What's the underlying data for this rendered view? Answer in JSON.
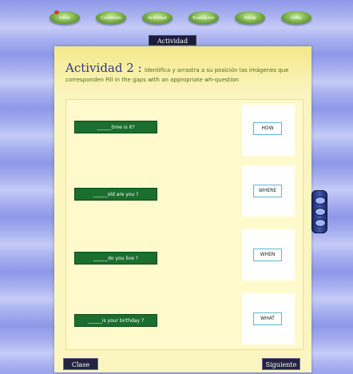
{
  "nav": {
    "items": [
      {
        "label": "Inicio",
        "icon": "leaf-icon"
      },
      {
        "label": "Contenido",
        "icon": "leaf-icon"
      },
      {
        "label": "Actividad",
        "icon": "leaf-icon"
      },
      {
        "label": "Evaluación",
        "icon": "leaf-icon"
      },
      {
        "label": "Vocab",
        "icon": "leaf-icon"
      },
      {
        "label": "Links",
        "icon": "leaf-icon"
      }
    ]
  },
  "section_tab": "Actividad",
  "activity": {
    "title": "Actividad 2 :",
    "instruction_line1": "Identifica y arrastra a su posición las imágenes que",
    "instruction_line2": "corresponden Fill in the gaps with an appropriate wh-question"
  },
  "questions": [
    "______time is it?",
    "______old are you ?",
    "______do you live ?",
    "______is your birthday ?"
  ],
  "answers": [
    "HOW",
    "WHERE",
    "WHEN",
    "WHAT"
  ],
  "footer": {
    "left_button": "Clase",
    "right_button": "Siguiente"
  },
  "colors": {
    "background": "#aab2f0",
    "panel": "#fbf5c0",
    "question_bg": "#1a6e2e",
    "answer_border": "#59b7d8",
    "button_bg": "#23233f"
  }
}
